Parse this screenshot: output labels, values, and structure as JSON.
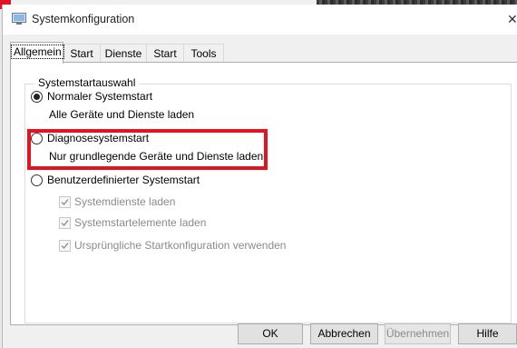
{
  "window": {
    "title": "Systemkonfiguration"
  },
  "tabs": [
    {
      "label": "Allgemein",
      "active": true
    },
    {
      "label": "Start"
    },
    {
      "label": "Dienste"
    },
    {
      "label": "Start"
    },
    {
      "label": "Tools"
    }
  ],
  "general": {
    "group_label": "Systemstartauswahl",
    "options": {
      "normal": {
        "label": "Normaler Systemstart",
        "description": "Alle Geräte und Dienste laden",
        "selected": true
      },
      "diagnostic": {
        "label": "Diagnosesystemstart",
        "description": "Nur grundlegende Geräte und Dienste laden",
        "selected": false
      },
      "selective": {
        "label": "Benutzerdefinierter Systemstart",
        "selected": false
      }
    },
    "checkboxes": [
      {
        "label": "Systemdienste laden",
        "checked": true,
        "enabled": false
      },
      {
        "label": "Systemstartelemente laden",
        "checked": true,
        "enabled": false
      },
      {
        "label": "Ursprüngliche Startkonfiguration verwenden",
        "checked": true,
        "enabled": false
      }
    ]
  },
  "buttons": {
    "ok": "OK",
    "cancel": "Abbrechen",
    "apply": "Übernehmen",
    "help": "Hilfe"
  },
  "colors": {
    "highlight": "#e3131f",
    "window_bg": "#f0f0f0",
    "panel_bg": "#ffffff"
  },
  "icons": {
    "title": "msconfig-icon",
    "close": "close-icon",
    "check": "checkmark-icon"
  }
}
